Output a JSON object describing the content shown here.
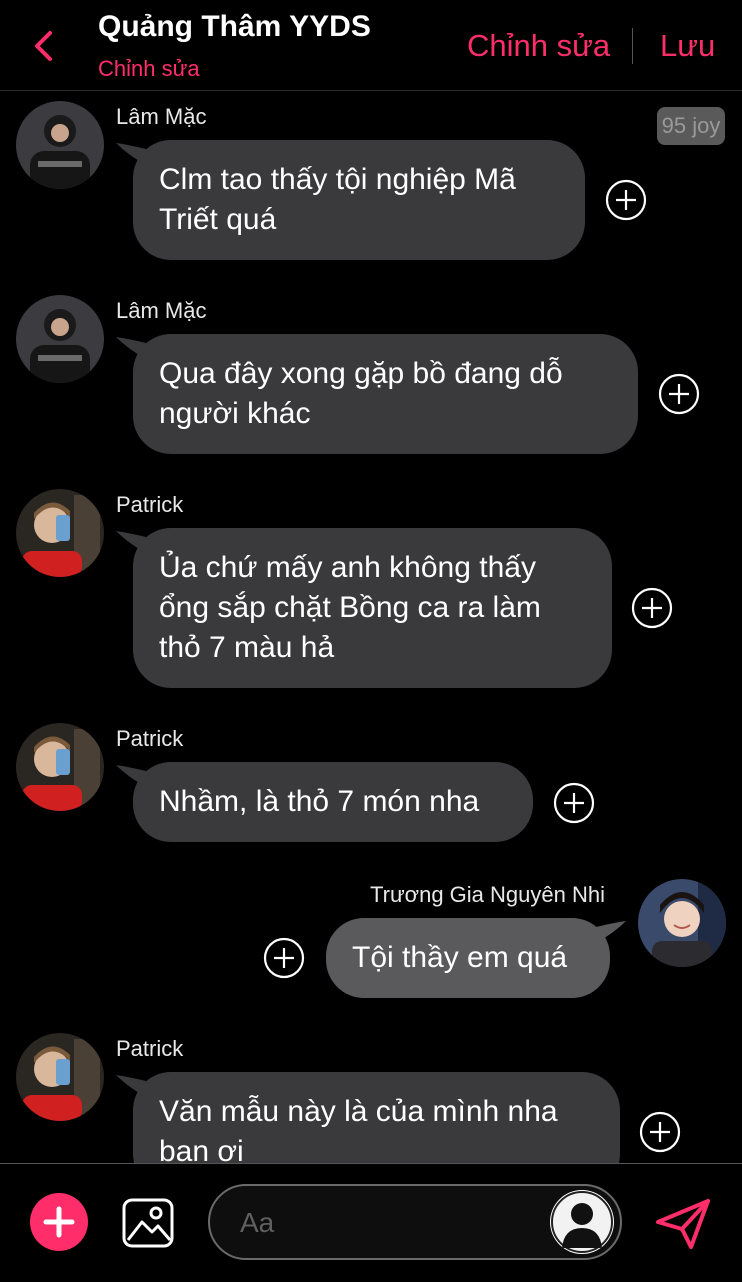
{
  "header": {
    "title": "Quảng Thâm YYDS",
    "subtitle": "Chỉnh sửa",
    "edit_label": "Chỉnh sửa",
    "save_label": "Lưu"
  },
  "badge": "95 joy",
  "messages": [
    {
      "sender": "Lâm Mặc",
      "lines": [
        "Clm tao thấy tội nghiệp Mã",
        "Triết quá"
      ]
    },
    {
      "sender": "Lâm Mặc",
      "lines": [
        "Qua đây xong gặp bồ đang dỗ",
        "người khác"
      ]
    },
    {
      "sender": "Patrick",
      "lines": [
        "Ủa chứ mấy anh không thấy",
        "ổng sắp chặt Bồng ca ra làm",
        "thỏ 7 màu hả"
      ]
    },
    {
      "sender": "Patrick",
      "lines": [
        "Nhầm, là thỏ 7 món nha"
      ]
    },
    {
      "sender": "Trương Gia Nguyên Nhi",
      "lines": [
        "Tội thầy em quá"
      ]
    },
    {
      "sender": "Patrick",
      "lines": [
        "Văn mẫu này là của mình nha",
        "bạn ơi"
      ]
    }
  ],
  "input": {
    "placeholder": "Aa"
  },
  "icons": {
    "back": "chevron-left-icon",
    "add": "plus-icon",
    "gallery": "image-icon",
    "sticker": "avatar-sticker-icon",
    "send": "send-icon",
    "react": "plus-circle-icon"
  },
  "colors": {
    "accent": "#ff2e6a",
    "bubble": "#3a3a3c",
    "bubble_mine": "#5a5a5d",
    "background": "#000000"
  }
}
